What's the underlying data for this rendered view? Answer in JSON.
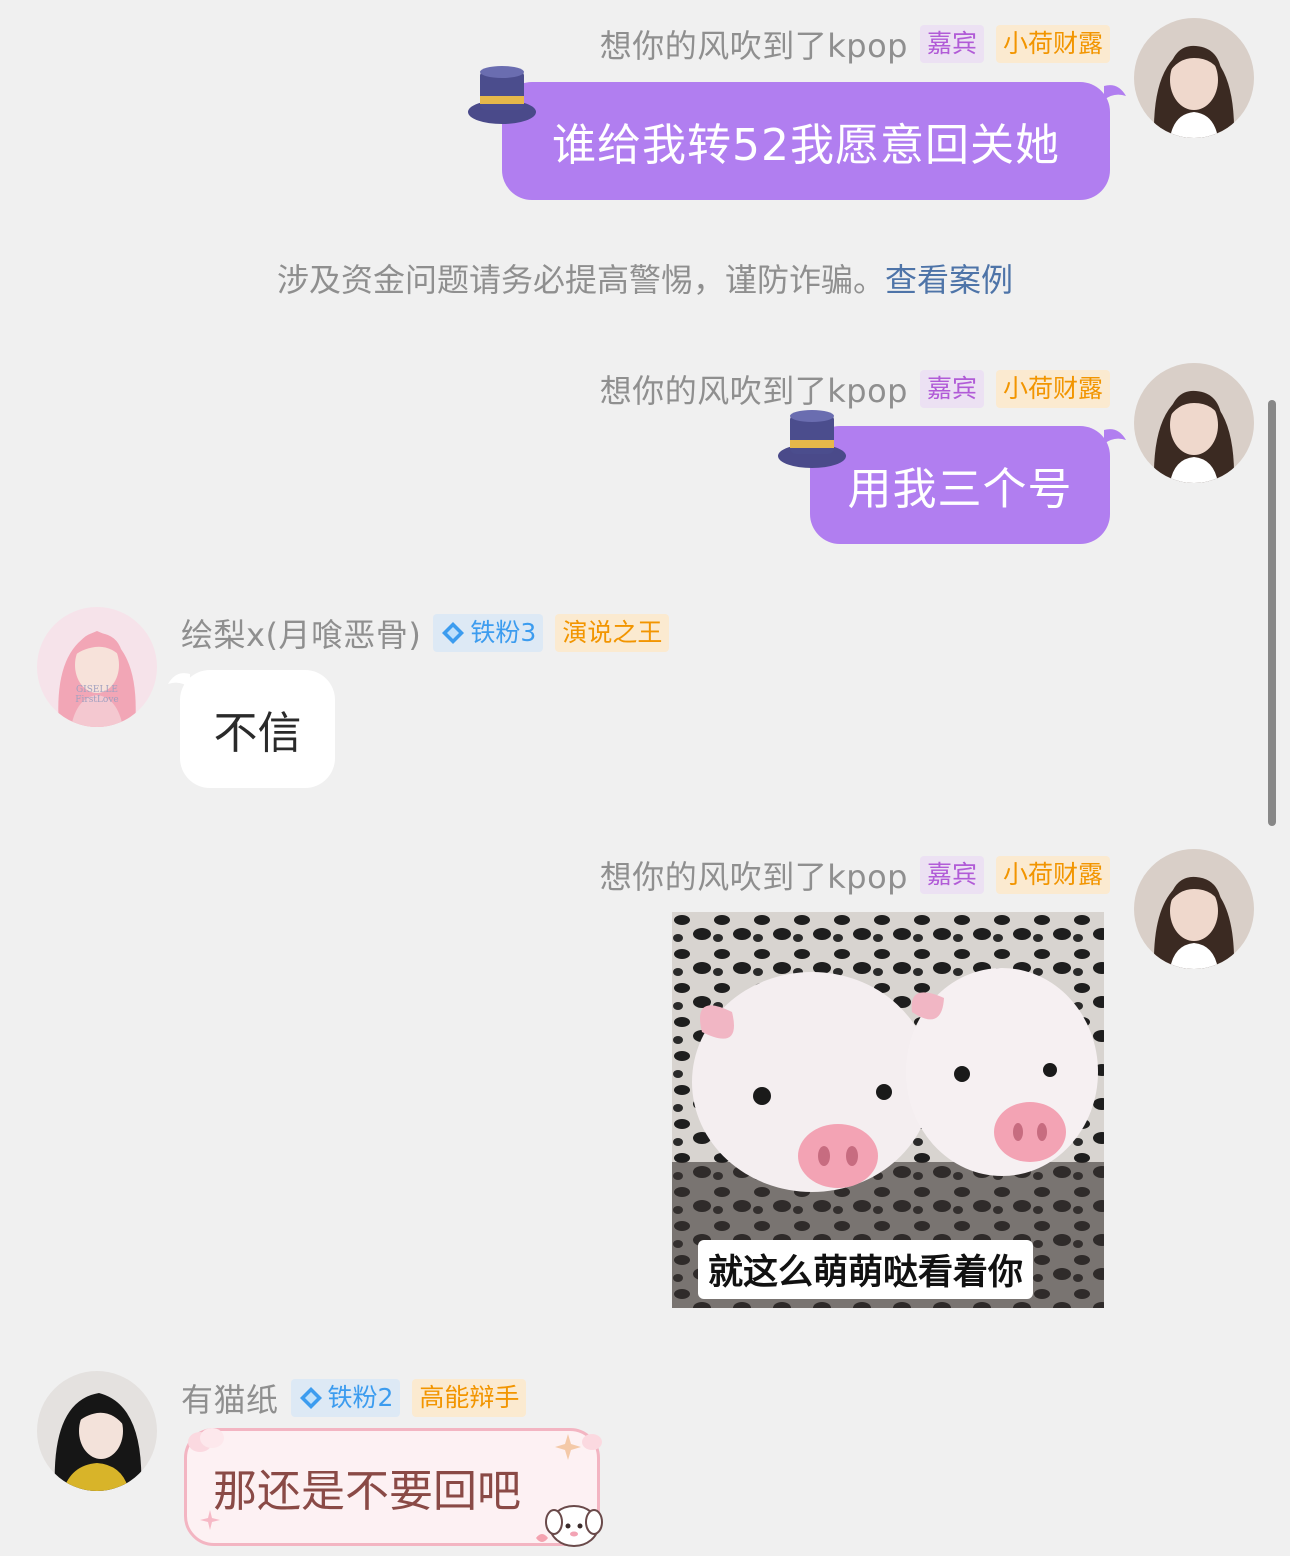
{
  "notice": {
    "text": "涉及资金问题请务必提高警惕，谨防诈骗。",
    "link": "查看案例"
  },
  "messages": [
    {
      "user": "想你的风吹到了kpop",
      "badges": [
        "嘉宾",
        "小荷财露"
      ],
      "text": "谁给我转52我愿意回关她",
      "hat_icon": "top-hat-icon"
    },
    {
      "user": "想你的风吹到了kpop",
      "badges": [
        "嘉宾",
        "小荷财露"
      ],
      "text": "用我三个号",
      "hat_icon": "top-hat-icon"
    },
    {
      "user": "绘梨x(月喰恶骨)",
      "badges": [
        "铁粉3",
        "演说之王"
      ],
      "text": "不信",
      "avatar_text": [
        "GISELLE",
        "FirstLove"
      ]
    },
    {
      "user": "想你的风吹到了kpop",
      "badges": [
        "嘉宾",
        "小荷财露"
      ],
      "image_caption": "就这么萌萌哒看着你",
      "image_subject": "two-piglets-photo"
    },
    {
      "user": "有猫纸",
      "badges": [
        "铁粉2",
        "高能辩手"
      ],
      "text": "那还是不要回吧"
    }
  ],
  "colors": {
    "background": "#f0f0f0",
    "purple_bubble": "#b17ef0",
    "guest_badge": "#b15bd7",
    "orange_badge": "#f29500",
    "fan_badge": "#3c9cef",
    "link": "#4e74a8"
  }
}
